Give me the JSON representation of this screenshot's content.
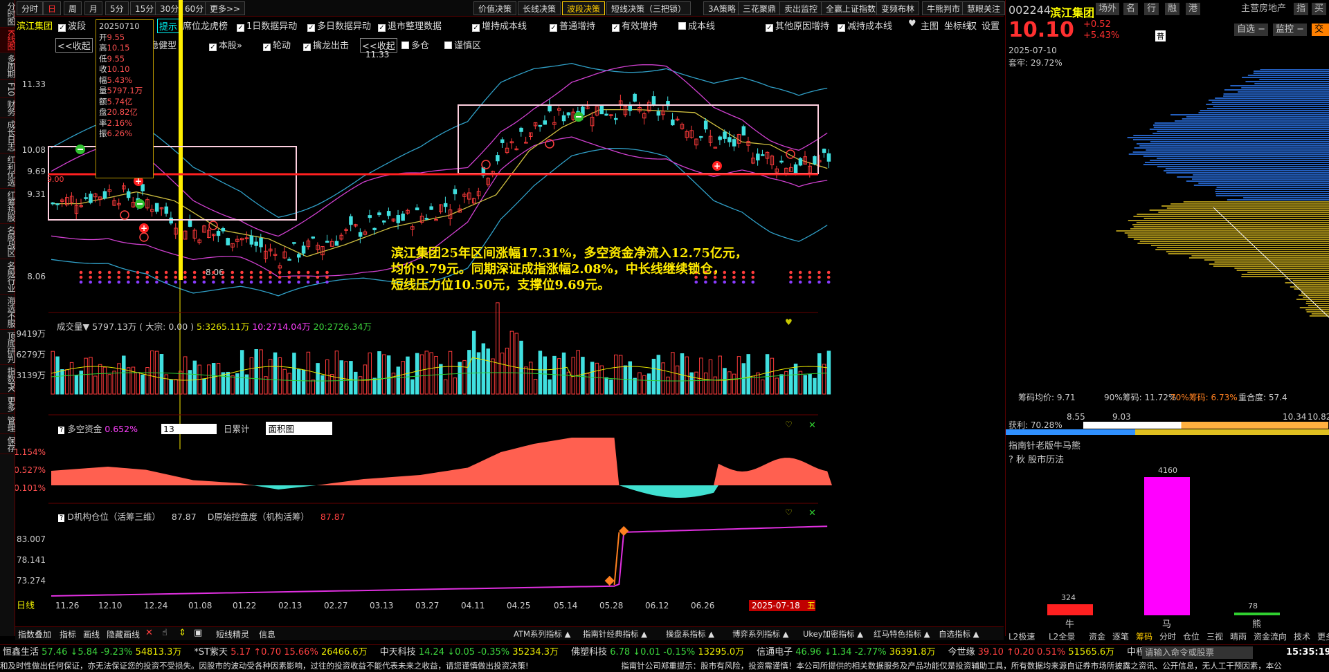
{
  "side_tabs": [
    "分时图",
    "K线图",
    "多周期",
    "F10",
    "财务",
    "成长日志",
    "红利优选",
    "红筹热股",
    "名股战区",
    "名股行业",
    "海选不服",
    "顶底研判",
    "指数PK",
    "更多",
    "管理",
    "保存"
  ],
  "period_tabs": [
    "分时",
    "日",
    "周",
    "月",
    "5分",
    "15分",
    "30分",
    "60分",
    "更多>>"
  ],
  "top_tabs": [
    "价值决策",
    "长线决策",
    "波段决策",
    "短线决策（三把锁）",
    "3A策略",
    "三花聚鼎",
    "卖出监控",
    "全赢上证指数",
    "变频布林",
    "牛熊判市",
    "慧眼关注"
  ],
  "row2": {
    "stock_label": "滨江集团",
    "mode": "波段",
    "tip": "提示",
    "items": [
      "席位龙虎榜",
      "1日数据异动",
      "多日数据异动",
      "退市整理数据",
      "增持成本线",
      "普通增持",
      "有效增持",
      "成本线",
      "其他原因增持",
      "减持成本线"
    ],
    "icons": [
      "主图",
      "坐标线",
      "权",
      "设置"
    ]
  },
  "row3": {
    "collapse1": "<<收起",
    "items": [
      "稳健型",
      "本股»",
      "轮动",
      "擒龙出击"
    ],
    "collapse2": "<<收起",
    "extra": [
      "多仓",
      "谨慎区"
    ]
  },
  "info_box": {
    "date": "20250710",
    "rows": [
      [
        "开",
        "9.55"
      ],
      [
        "高",
        "10.15"
      ],
      [
        "低",
        "9.55"
      ],
      [
        "收",
        "10.10"
      ],
      [
        "幅",
        "5.43%"
      ],
      [
        "量",
        "5797.1万"
      ],
      [
        "额",
        "5.74亿"
      ],
      [
        "盘",
        "20.82亿"
      ],
      [
        "率",
        "2.16%"
      ],
      [
        "振",
        "6.26%"
      ]
    ]
  },
  "price_axis": [
    "11.33",
    "10.08",
    "9.69",
    "9.31",
    "8.06"
  ],
  "max_label": "11.33",
  "min_label": "8.06",
  "low_left": "9.00",
  "annotation": "滨江集团25年区间涨幅17.31%，多空资金净流入12.75亿元，\n均价9.79元。同期深证成指涨幅2.08%，中长线继续锁仓，\n短线压力位10.50元，支撑位9.69元。",
  "volume": {
    "title": "成交量▼",
    "value": "5797.13万",
    "big": "( 大宗: 0.00 )",
    "ma5": "5:3265.11万",
    "ma10": "10:2714.04万",
    "ma20": "20:2726.34万",
    "axis": [
      "9419万",
      "6279万",
      "3139万"
    ]
  },
  "capital": {
    "title": "多空资金",
    "value": "0.652%",
    "period": "13",
    "mode": "日累计",
    "style": "面积图",
    "axis": [
      "1.154%",
      "0.527%",
      "-0.101%"
    ]
  },
  "inst": {
    "title": "D机构仓位（活筹三维）",
    "value": "87.87",
    "sub": "D原始控盘度（机构活筹）",
    "sub_value": "87.87",
    "axis": [
      "83.007",
      "78.141",
      "73.274"
    ]
  },
  "date_axis": {
    "label": "日线",
    "dates": [
      "11.26",
      "12.10",
      "12.24",
      "01.08",
      "01.22",
      "02.13",
      "02.27",
      "03.13",
      "03.27",
      "04.11",
      "04.25",
      "05.14",
      "05.28",
      "06.12",
      "06.26"
    ],
    "current": "2025-07-18",
    "weekday": "五"
  },
  "bottom_bar": {
    "left": [
      "指数叠加",
      "指标",
      "画线",
      "隐藏画线"
    ],
    "right_left": [
      "短线精灵",
      "信息"
    ],
    "groups": [
      "ATM系列指标 ▲",
      "指南针经典指标 ▲",
      "操盘系指标 ▲",
      "博弈系列指标 ▲",
      "Ukey加密指标 ▲",
      "红马特色指标 ▲",
      "自选指标 ▲"
    ]
  },
  "right": {
    "code": "002244",
    "name": "滨江集团",
    "tags": [
      "场外",
      "名",
      "行",
      "融",
      "港"
    ],
    "industry": "主营房地产",
    "tags2": [
      "指",
      "买"
    ],
    "price": "10.10",
    "chg": "+0.52",
    "pct": "+5.43%",
    "btns": [
      "自选",
      "监控",
      "交易"
    ],
    "date": "2025-07-10",
    "lock": "套牢: 29.72%",
    "chip_avg": "筹码均价: 9.71",
    "chip90": "90%筹码: 11.72%",
    "chip70": "70%筹码: 6.73%",
    "overlap": "重合度: 57.4",
    "profit": "获利: 70.28%",
    "bar_ticks": [
      "8.55",
      "9.03",
      "10.34",
      "10.82"
    ],
    "bull_title": "指南针老版牛马熊",
    "bull_sub": "秋 股市历法",
    "bars": [
      {
        "name": "牛",
        "value": 324,
        "color": "#ff2020"
      },
      {
        "name": "马",
        "value": 4160,
        "color": "#ff00ff"
      },
      {
        "name": "熊",
        "value": 78,
        "color": "#30d030"
      }
    ],
    "bottom_tabs": [
      "L2极速",
      "L2全景",
      "资金",
      "逐笔",
      "筹码",
      "分时",
      "仓位",
      "三视",
      "晴雨",
      "资金流向",
      "技术",
      "更多»"
    ]
  },
  "ticker": [
    {
      "name": "恒鑫生活",
      "p": "57.46",
      "c": "↓5.84",
      "pc": "-9.23%",
      "v": "54813.3万",
      "d": "dn"
    },
    {
      "name": "*ST紫天",
      "p": "5.17",
      "c": "↑0.70",
      "pc": "15.66%",
      "v": "26466.6万",
      "d": "up"
    },
    {
      "name": "中天科技",
      "p": "14.24",
      "c": "↓0.05",
      "pc": "-0.35%",
      "v": "35234.3万",
      "d": "dn"
    },
    {
      "name": "佛塑科技",
      "p": "6.78",
      "c": "↓0.01",
      "pc": "-0.15%",
      "v": "13295.0万",
      "d": "dn"
    },
    {
      "name": "信通电子",
      "p": "46.96",
      "c": "↓1.34",
      "pc": "-2.77%",
      "v": "36391.8万",
      "d": "dn"
    },
    {
      "name": "今世缘",
      "p": "39.10",
      "c": "↑0.20",
      "pc": "0.51%",
      "v": "51565.6万",
      "d": "up"
    },
    {
      "name": "中程退",
      "p": "",
      "c": "",
      "pc": "",
      "v": "",
      "d": "dn"
    }
  ],
  "cmd_placeholder": "请输入命令或股票",
  "clock": "15:35:19",
  "disclaimer_left": "和及时性做出任何保证，亦无法保证您的投资不受损失。因股市的波动受各种因素影响，过往的投资收益不能代表未来之收益，请您谨慎做出投资决策!",
  "disclaimer_right": "指南针公司郑重提示：股市有风险，投资需谨慎！本公司所提供的相关数据服务及产品功能仅是投资辅助工具，所有数据均来源自证券市场所披露之资讯、公开信息，无人工干预因素，本公"
}
